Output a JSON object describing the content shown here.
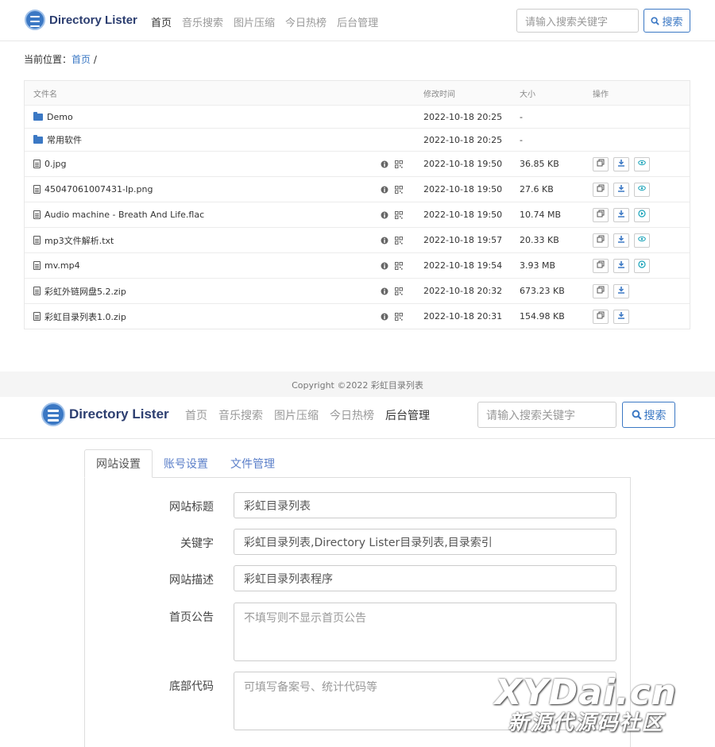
{
  "site": {
    "logo_text": "Directory Lister"
  },
  "nav": {
    "links": [
      "首页",
      "音乐搜索",
      "图片压缩",
      "今日热榜",
      "后台管理"
    ],
    "search_placeholder": "请输入搜索关键字",
    "search_button": "搜索"
  },
  "breadcrumb": {
    "prefix": "当前位置：",
    "home": "首页",
    "sep": "/"
  },
  "table": {
    "headers": [
      "文件名",
      "修改时间",
      "大小",
      "操作"
    ],
    "rows": [
      {
        "name": "Demo",
        "time": "2022-10-18 20:25",
        "size": "-",
        "type": "folder"
      },
      {
        "name": "常用软件",
        "time": "2022-10-18 20:25",
        "size": "-",
        "type": "folder"
      },
      {
        "name": "0.jpg",
        "time": "2022-10-18 19:50",
        "size": "36.85 KB",
        "type": "image"
      },
      {
        "name": "45047061007431-lp.png",
        "time": "2022-10-18 19:50",
        "size": "27.6 KB",
        "type": "image"
      },
      {
        "name": "Audio machine - Breath And Life.flac",
        "time": "2022-10-18 19:50",
        "size": "10.74 MB",
        "type": "audio"
      },
      {
        "name": "mp3文件解析.txt",
        "time": "2022-10-18 19:57",
        "size": "20.33 KB",
        "type": "text"
      },
      {
        "name": "mv.mp4",
        "time": "2022-10-18 19:54",
        "size": "3.93 MB",
        "type": "video"
      },
      {
        "name": "彩虹外链网盘5.2.zip",
        "time": "2022-10-18 20:32",
        "size": "673.23 KB",
        "type": "zip"
      },
      {
        "name": "彩虹目录列表1.0.zip",
        "time": "2022-10-18 20:31",
        "size": "154.98 KB",
        "type": "zip"
      }
    ]
  },
  "footer": {
    "copyright": "Copyright ©2022 彩虹目录列表"
  },
  "admin": {
    "tabs": [
      "网站设置",
      "账号设置",
      "文件管理"
    ],
    "fields": [
      {
        "label": "网站标题",
        "value": "彩虹目录列表"
      },
      {
        "label": "关键字",
        "value": "彩虹目录列表,Directory Lister目录列表,目录索引"
      },
      {
        "label": "网站描述",
        "value": "彩虹目录列表程序"
      },
      {
        "label": "首页公告",
        "placeholder": "不填写则不显示首页公告"
      },
      {
        "label": "底部代码",
        "placeholder": "可填写备案号、统计代码等"
      }
    ]
  },
  "watermark": {
    "line1": "XYDai.cn",
    "line2": "新源代源码社区"
  },
  "colors": {
    "accent": "#3b78c4",
    "border": "#e7e7e7"
  }
}
